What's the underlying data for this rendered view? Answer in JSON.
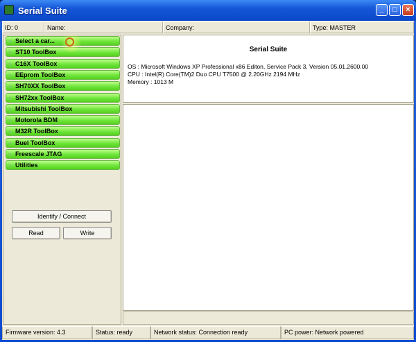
{
  "window": {
    "title": "Serial Suite",
    "minimize": "_",
    "maximize": "□",
    "close": "×"
  },
  "header": {
    "id": "ID: 0",
    "name": "Name:",
    "company": "Company:",
    "type": "Type: MASTER"
  },
  "menu": [
    {
      "label": "Select a car..."
    },
    {
      "label": "ST10 ToolBox"
    },
    {
      "label": "C16X ToolBox"
    },
    {
      "label": "EEprom ToolBox"
    },
    {
      "label": "SH70XX ToolBox"
    },
    {
      "label": "SH72xx ToolBox"
    },
    {
      "label": "Mitsubishi ToolBox"
    },
    {
      "label": "Motorola BDM"
    },
    {
      "label": "M32R ToolBox"
    },
    {
      "label": "Buel ToolBox"
    },
    {
      "label": "Freescale JTAG"
    },
    {
      "label": "Utilities"
    }
  ],
  "buttons": {
    "identify": "Identify / Connect",
    "read": "Read",
    "write": "Write"
  },
  "info": {
    "title": "Serial Suite",
    "os": "OS : Microsoft Windows XP Professional x86 Editon, Service Pack 3, Version 05.01.2600.00",
    "cpu": "CPU : Intel(R) Core(TM)2 Duo CPU     T7500  @ 2.20GHz 2194 MHz",
    "memory": "Memory : 1013 M"
  },
  "status": {
    "firmware": "Firmware version: 4.3",
    "status": "Status: ready",
    "network": "Network status: Connection ready",
    "power": "PC power: Network powered"
  }
}
